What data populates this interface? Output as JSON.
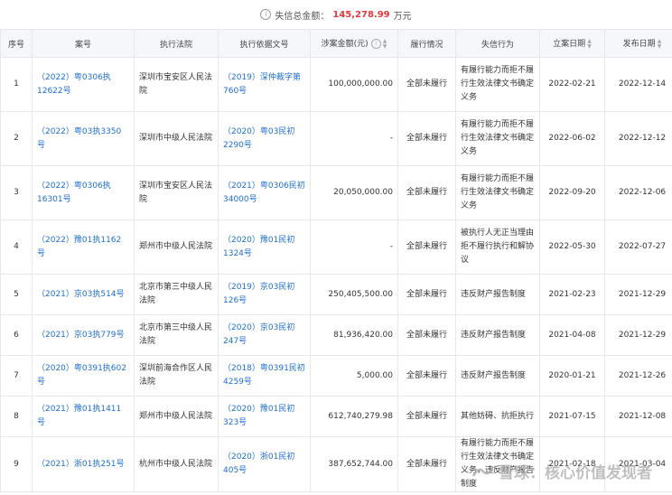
{
  "summary": {
    "label": "失信总金额：",
    "amount": "145,278.99",
    "unit": "万元"
  },
  "headers": [
    "序号",
    "案号",
    "执行法院",
    "执行依据文号",
    "涉案金额(元)",
    "履行情况",
    "失信行为",
    "立案日期",
    "发布日期"
  ],
  "rows": [
    {
      "no": "1",
      "case": "（2022）粤0306执12622号",
      "court": "深圳市宝安区人民法院",
      "basis": "（2019）深仲裁字第760号",
      "amount": "100,000,000.00",
      "status": "全部未履行",
      "behavior": "有履行能力而拒不履行生效法律文书确定义务",
      "filed": "2022-02-21",
      "published": "2022-12-14"
    },
    {
      "no": "2",
      "case": "（2022）粤03执3350号",
      "court": "深圳市中级人民法院",
      "basis": "（2020）粤03民初2290号",
      "amount": "-",
      "status": "全部未履行",
      "behavior": "有履行能力而拒不履行生效法律文书确定义务",
      "filed": "2022-06-02",
      "published": "2022-12-12"
    },
    {
      "no": "3",
      "case": "（2022）粤0306执16301号",
      "court": "深圳市宝安区人民法院",
      "basis": "（2021）粤0306民初34000号",
      "amount": "20,050,000.00",
      "status": "全部未履行",
      "behavior": "有履行能力而拒不履行生效法律文书确定义务",
      "filed": "2022-09-20",
      "published": "2022-12-06"
    },
    {
      "no": "4",
      "case": "（2022）豫01执1162号",
      "court": "郑州市中级人民法院",
      "basis": "（2020）豫01民初1324号",
      "amount": "-",
      "status": "全部未履行",
      "behavior": "被执行人无正当理由拒不履行执行和解协议",
      "filed": "2022-05-30",
      "published": "2022-07-27"
    },
    {
      "no": "5",
      "case": "（2021）京03执514号",
      "court": "北京市第三中级人民法院",
      "basis": "（2019）京03民初126号",
      "amount": "250,405,500.00",
      "status": "全部未履行",
      "behavior": "违反财产报告制度",
      "filed": "2021-02-23",
      "published": "2021-12-29"
    },
    {
      "no": "6",
      "case": "（2021）京03执779号",
      "court": "北京市第三中级人民法院",
      "basis": "（2020）京03民初247号",
      "amount": "81,936,420.00",
      "status": "全部未履行",
      "behavior": "违反财产报告制度",
      "filed": "2021-04-08",
      "published": "2021-12-29"
    },
    {
      "no": "7",
      "case": "（2020）粤0391执602号",
      "court": "深圳前海合作区人民法院",
      "basis": "（2018）粤0391民初4259号",
      "amount": "5,000.00",
      "status": "全部未履行",
      "behavior": "违反财产报告制度",
      "filed": "2020-01-21",
      "published": "2021-12-26"
    },
    {
      "no": "8",
      "case": "（2021）豫01执1411号",
      "court": "郑州市中级人民法院",
      "basis": "（2020）豫01民初323号",
      "amount": "612,740,279.98",
      "status": "全部未履行",
      "behavior": "其他妨碍、抗拒执行",
      "filed": "2021-07-15",
      "published": "2021-12-08"
    },
    {
      "no": "9",
      "case": "（2021）浙01执251号",
      "court": "杭州市中级人民法院",
      "basis": "（2020）浙01民初405号",
      "amount": "387,652,744.00",
      "status": "全部未履行",
      "behavior": "有履行能力而拒不履行生效法律文书确定义务，违反财产报告制度",
      "filed": "2021-02-18",
      "published": "2021-03-04"
    }
  ],
  "watermark": "雪球：核心价值发现者"
}
